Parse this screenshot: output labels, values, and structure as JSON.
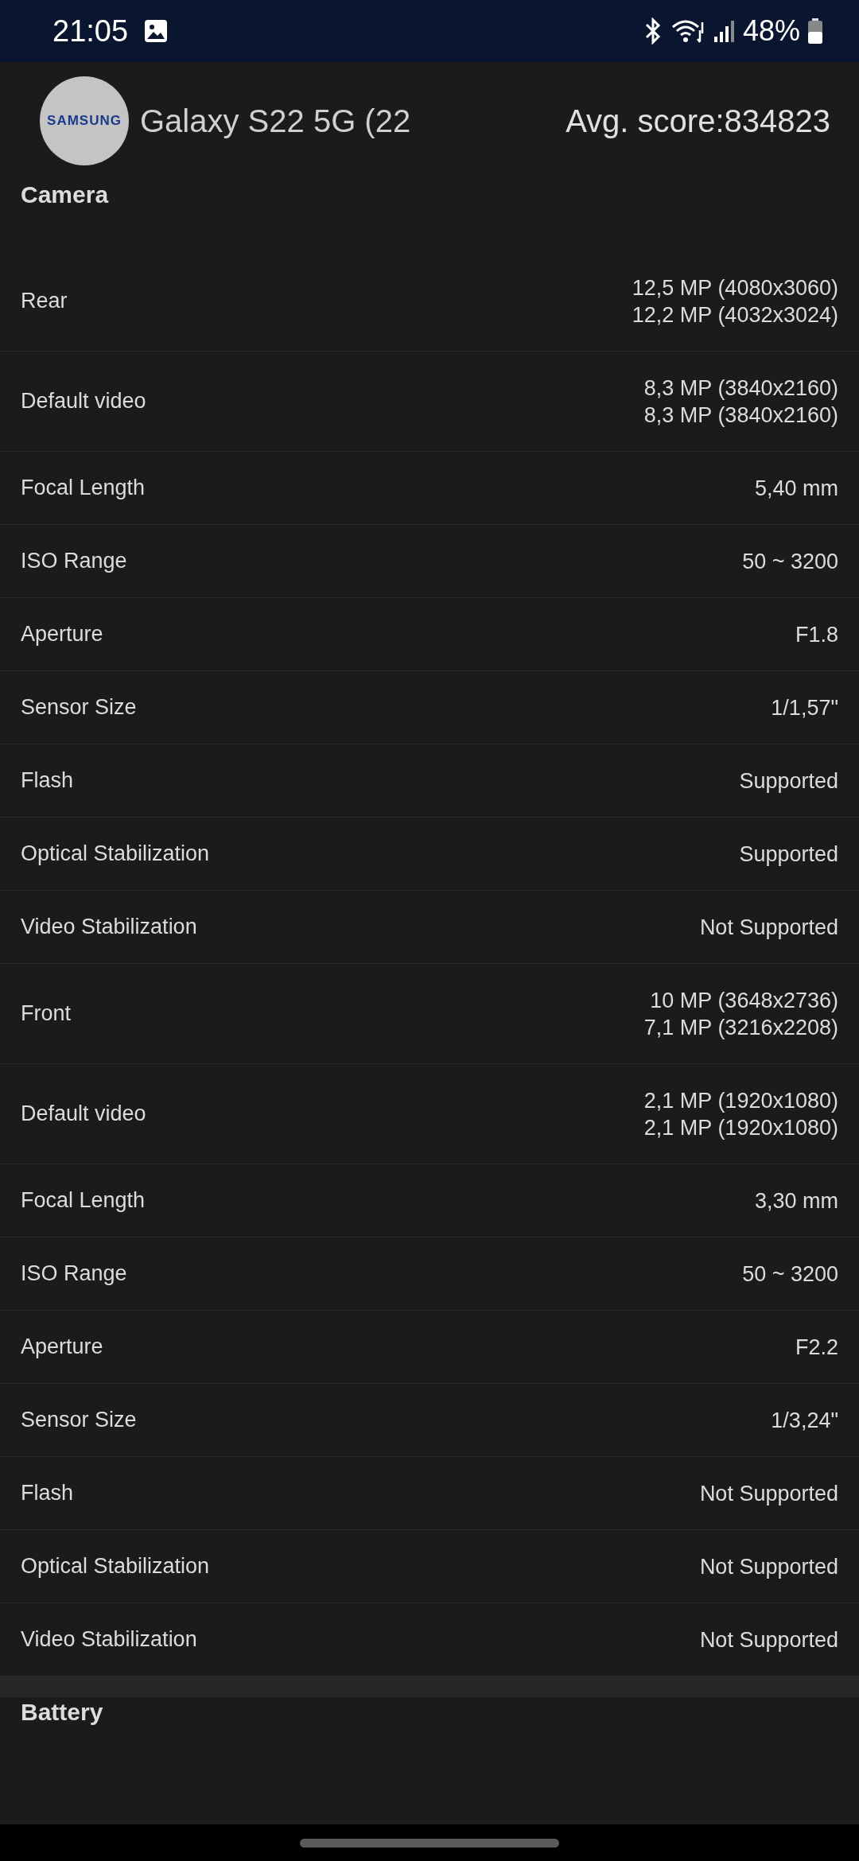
{
  "status_bar": {
    "time": "21:05",
    "battery": "48%"
  },
  "header": {
    "logo": "SAMSUNG",
    "device": "Galaxy S22 5G (22",
    "score": "Avg. score:834823"
  },
  "sections": [
    {
      "title": "Camera",
      "rows": [
        {
          "label": "Rear",
          "values": [
            "12,5 MP (4080x3060)",
            "12,2 MP (4032x3024)"
          ]
        },
        {
          "label": "Default video",
          "values": [
            "8,3 MP (3840x2160)",
            "8,3 MP (3840x2160)"
          ]
        },
        {
          "label": "Focal Length",
          "values": [
            "5,40 mm"
          ]
        },
        {
          "label": "ISO Range",
          "values": [
            "50 ~ 3200"
          ]
        },
        {
          "label": "Aperture",
          "values": [
            "F1.8"
          ]
        },
        {
          "label": "Sensor Size",
          "values": [
            "1/1,57\""
          ]
        },
        {
          "label": "Flash",
          "values": [
            "Supported"
          ]
        },
        {
          "label": "Optical Stabilization",
          "values": [
            "Supported"
          ]
        },
        {
          "label": "Video Stabilization",
          "values": [
            "Not Supported"
          ]
        },
        {
          "label": "Front",
          "values": [
            "10 MP (3648x2736)",
            "7,1 MP (3216x2208)"
          ]
        },
        {
          "label": "Default video",
          "values": [
            "2,1 MP (1920x1080)",
            "2,1 MP (1920x1080)"
          ]
        },
        {
          "label": "Focal Length",
          "values": [
            "3,30 mm"
          ]
        },
        {
          "label": "ISO Range",
          "values": [
            "50 ~ 3200"
          ]
        },
        {
          "label": "Aperture",
          "values": [
            "F2.2"
          ]
        },
        {
          "label": "Sensor Size",
          "values": [
            "1/3,24\""
          ]
        },
        {
          "label": "Flash",
          "values": [
            "Not Supported"
          ]
        },
        {
          "label": "Optical Stabilization",
          "values": [
            "Not Supported"
          ]
        },
        {
          "label": "Video Stabilization",
          "values": [
            "Not Supported"
          ]
        }
      ]
    },
    {
      "title": "Battery"
    }
  ]
}
